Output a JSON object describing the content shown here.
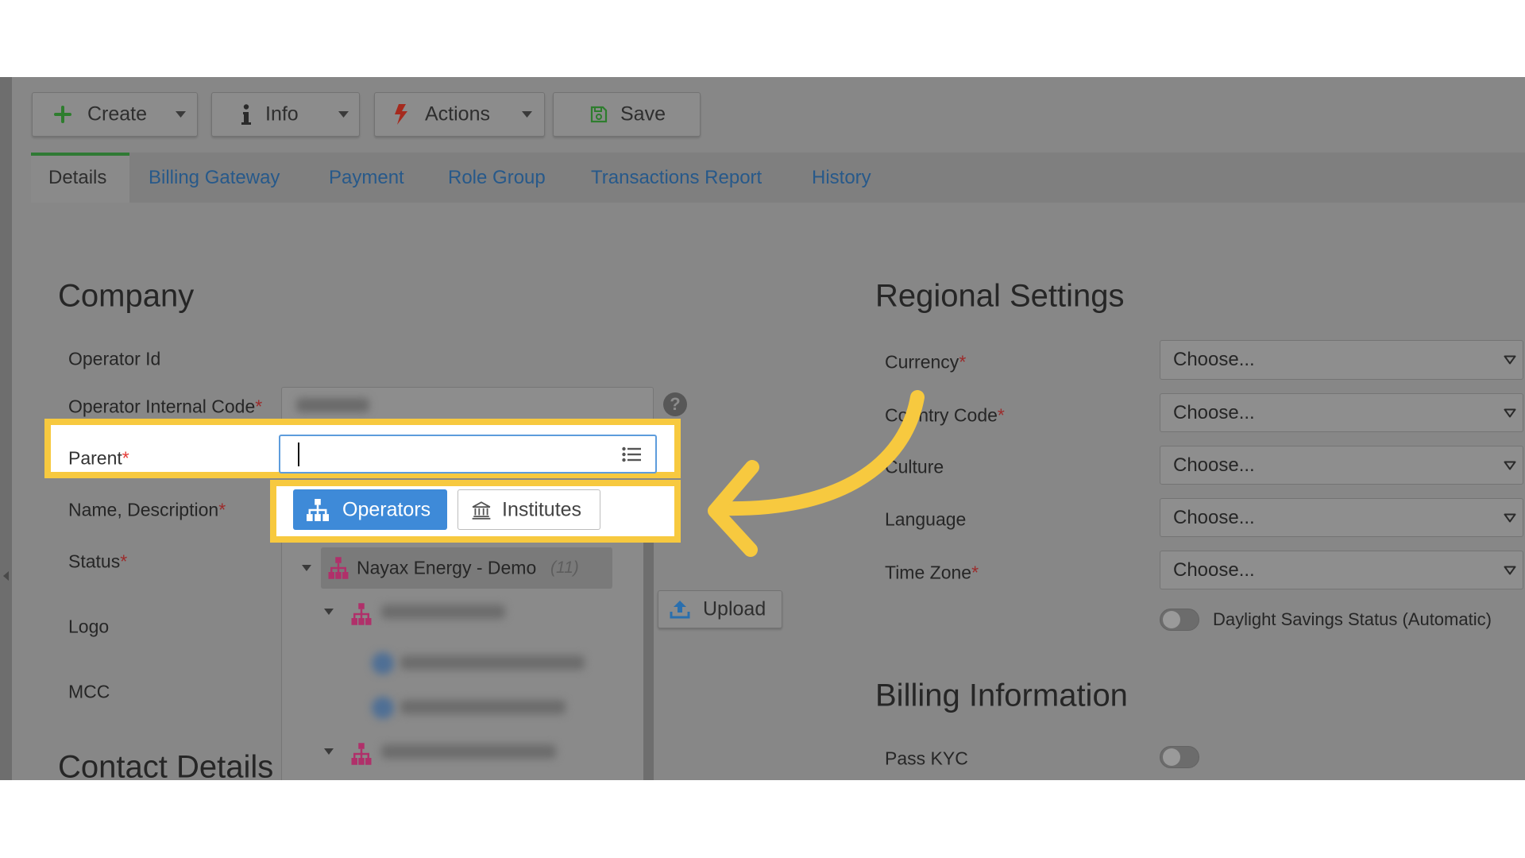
{
  "toolbar": {
    "create": {
      "label": "Create",
      "icon": "plus-icon"
    },
    "info": {
      "label": "Info",
      "icon": "info-icon"
    },
    "actions": {
      "label": "Actions",
      "icon": "bolt-icon"
    },
    "save": {
      "label": "Save",
      "icon": "save-icon"
    }
  },
  "tabs": [
    {
      "label": "Details",
      "active": true
    },
    {
      "label": "Billing Gateway"
    },
    {
      "label": "Payment"
    },
    {
      "label": "Role Group"
    },
    {
      "label": "Transactions Report"
    },
    {
      "label": "History"
    }
  ],
  "company": {
    "heading": "Company",
    "fields": [
      {
        "label": "Operator Id"
      },
      {
        "label": "Operator Internal Code",
        "required": "*"
      },
      {
        "label": "Parent",
        "required": "*"
      },
      {
        "label": "Name, Description",
        "required": "*"
      },
      {
        "label": "Status",
        "required": "*"
      },
      {
        "label": "Logo"
      },
      {
        "label": "MCC"
      }
    ],
    "help_glyph": "?"
  },
  "parent_picker": {
    "input_value": "",
    "list_icon": "list-icon",
    "tabs": [
      {
        "label": "Operators",
        "icon": "sitemap-icon",
        "active": true
      },
      {
        "label": "Institutes",
        "icon": "bank-icon"
      }
    ],
    "tree": {
      "root": {
        "label": "Nayax Energy - Demo",
        "count": "(11)",
        "icon": "sitemap-icon"
      }
    }
  },
  "upload": {
    "label": "Upload",
    "icon": "upload-icon"
  },
  "contact": {
    "heading": "Contact Details"
  },
  "regional": {
    "heading": "Regional Settings",
    "fields": [
      {
        "label": "Currency",
        "required": "*",
        "value": "Choose..."
      },
      {
        "label": "Country Code",
        "required": "*",
        "value": "Choose..."
      },
      {
        "label": "Culture",
        "value": "Choose..."
      },
      {
        "label": "Language",
        "value": "Choose..."
      },
      {
        "label": "Time Zone",
        "required": "*",
        "value": "Choose..."
      }
    ],
    "daylight": {
      "label": "Daylight Savings Status (Automatic)",
      "on": false
    }
  },
  "billing": {
    "heading": "Billing Information",
    "pass_kyc": {
      "label": "Pass KYC",
      "on": false
    }
  },
  "colors": {
    "highlight": "#f7c93f",
    "arrow": "#f7c93f",
    "primary_blue": "#3e8ad8",
    "required_red": "#e53935",
    "active_tab_green": "#2f7a34",
    "org_icon_pink": "#b0306a"
  }
}
